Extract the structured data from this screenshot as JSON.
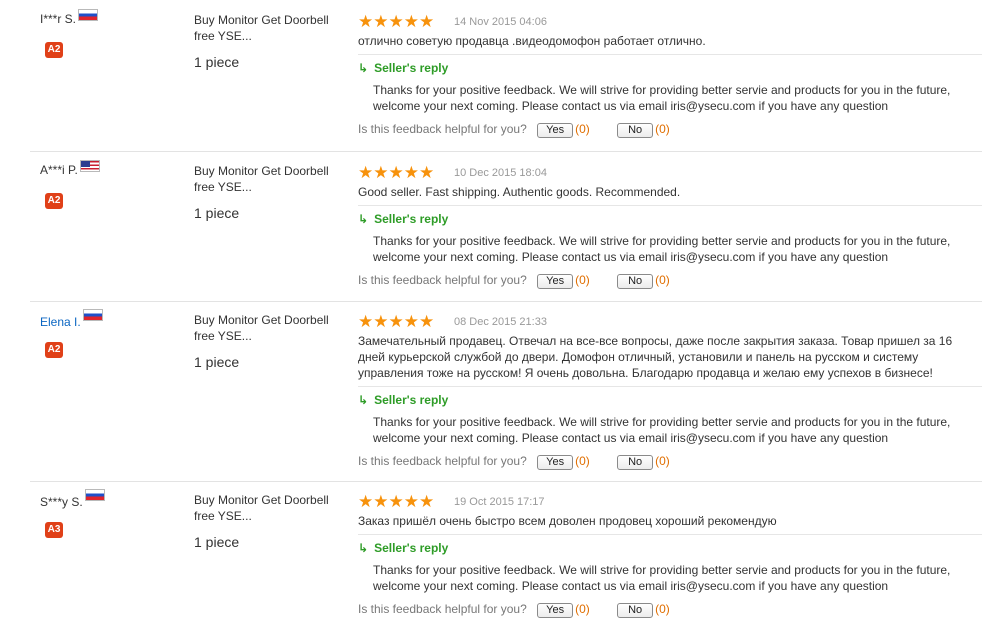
{
  "helpful_question": "Is this feedback helpful for you?",
  "yes_label": "Yes",
  "no_label": "No",
  "reply_title": "Seller's reply",
  "reviews": [
    {
      "buyer": "I***r S.",
      "flag": "ru",
      "badge": "A2",
      "product_title": "Buy Monitor Get Doorbell free YSE...",
      "quantity": "1 piece",
      "rating": 5,
      "date": "14 Nov 2015 04:06",
      "text": "отлично советую продавца .видеодомофон работает отлично.",
      "reply": "Thanks for your positive feedback. We will strive for providing better servie and products for you in the future, welcome your next coming. Please contact us via email iris@ysecu.com if you have any question",
      "yes_count": "(0)",
      "no_count": "(0)"
    },
    {
      "buyer": "A***i P.",
      "flag": "us",
      "badge": "A2",
      "product_title": "Buy Monitor Get Doorbell free YSE...",
      "quantity": "1 piece",
      "rating": 5,
      "date": "10 Dec 2015 18:04",
      "text": "Good seller. Fast shipping. Authentic goods. Recommended.",
      "reply": "Thanks for your positive feedback. We will strive for providing better servie and products for you in the future, welcome your next coming. Please contact us via email iris@ysecu.com if you have any question",
      "yes_count": "(0)",
      "no_count": "(0)"
    },
    {
      "buyer": "Elena I.",
      "flag": "ru",
      "badge": "A2",
      "product_title": "Buy Monitor Get Doorbell free YSE...",
      "quantity": "1 piece",
      "rating": 5,
      "date": "08 Dec 2015 21:33",
      "text": "Замечательный продавец. Отвечал на все-все вопросы, даже после закрытия заказа. Товар пришел за 16 дней курьерской службой до двери. Домофон отличный, установили и панель на русском и систему управления тоже на русском! Я очень довольна. Благодарю продавца и желаю ему успехов в бизнесе!",
      "reply": "Thanks for your positive feedback. We will strive for providing better servie and products for you in the future, welcome your next coming. Please contact us via email iris@ysecu.com if you have any question",
      "yes_count": "(0)",
      "no_count": "(0)"
    },
    {
      "buyer": "S***y S.",
      "flag": "ru",
      "badge": "A3",
      "product_title": "Buy Monitor Get Doorbell free YSE...",
      "quantity": "1 piece",
      "rating": 5,
      "date": "19 Oct 2015 17:17",
      "text": "Заказ пришёл очень быстро всем доволен продовец хороший рекомендую",
      "reply": "Thanks for your positive feedback. We will strive for providing better servie and products for you in the future, welcome your next coming. Please contact us via email iris@ysecu.com if you have any question",
      "yes_count": "(0)",
      "no_count": "(0)"
    }
  ]
}
